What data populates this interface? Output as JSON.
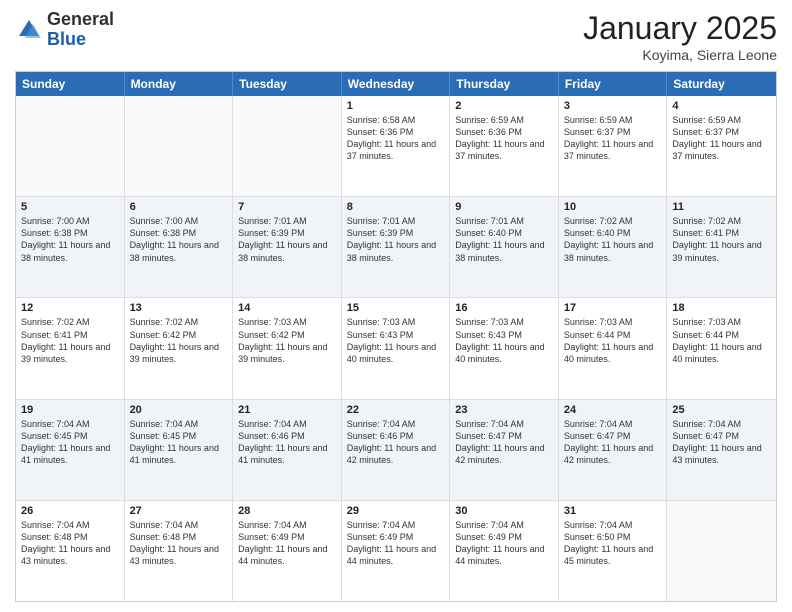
{
  "logo": {
    "general": "General",
    "blue": "Blue"
  },
  "header": {
    "month": "January 2025",
    "location": "Koyima, Sierra Leone"
  },
  "weekdays": [
    "Sunday",
    "Monday",
    "Tuesday",
    "Wednesday",
    "Thursday",
    "Friday",
    "Saturday"
  ],
  "rows": [
    {
      "alt": false,
      "cells": [
        {
          "day": "",
          "text": ""
        },
        {
          "day": "",
          "text": ""
        },
        {
          "day": "",
          "text": ""
        },
        {
          "day": "1",
          "text": "Sunrise: 6:58 AM\nSunset: 6:36 PM\nDaylight: 11 hours and 37 minutes."
        },
        {
          "day": "2",
          "text": "Sunrise: 6:59 AM\nSunset: 6:36 PM\nDaylight: 11 hours and 37 minutes."
        },
        {
          "day": "3",
          "text": "Sunrise: 6:59 AM\nSunset: 6:37 PM\nDaylight: 11 hours and 37 minutes."
        },
        {
          "day": "4",
          "text": "Sunrise: 6:59 AM\nSunset: 6:37 PM\nDaylight: 11 hours and 37 minutes."
        }
      ]
    },
    {
      "alt": true,
      "cells": [
        {
          "day": "5",
          "text": "Sunrise: 7:00 AM\nSunset: 6:38 PM\nDaylight: 11 hours and 38 minutes."
        },
        {
          "day": "6",
          "text": "Sunrise: 7:00 AM\nSunset: 6:38 PM\nDaylight: 11 hours and 38 minutes."
        },
        {
          "day": "7",
          "text": "Sunrise: 7:01 AM\nSunset: 6:39 PM\nDaylight: 11 hours and 38 minutes."
        },
        {
          "day": "8",
          "text": "Sunrise: 7:01 AM\nSunset: 6:39 PM\nDaylight: 11 hours and 38 minutes."
        },
        {
          "day": "9",
          "text": "Sunrise: 7:01 AM\nSunset: 6:40 PM\nDaylight: 11 hours and 38 minutes."
        },
        {
          "day": "10",
          "text": "Sunrise: 7:02 AM\nSunset: 6:40 PM\nDaylight: 11 hours and 38 minutes."
        },
        {
          "day": "11",
          "text": "Sunrise: 7:02 AM\nSunset: 6:41 PM\nDaylight: 11 hours and 39 minutes."
        }
      ]
    },
    {
      "alt": false,
      "cells": [
        {
          "day": "12",
          "text": "Sunrise: 7:02 AM\nSunset: 6:41 PM\nDaylight: 11 hours and 39 minutes."
        },
        {
          "day": "13",
          "text": "Sunrise: 7:02 AM\nSunset: 6:42 PM\nDaylight: 11 hours and 39 minutes."
        },
        {
          "day": "14",
          "text": "Sunrise: 7:03 AM\nSunset: 6:42 PM\nDaylight: 11 hours and 39 minutes."
        },
        {
          "day": "15",
          "text": "Sunrise: 7:03 AM\nSunset: 6:43 PM\nDaylight: 11 hours and 40 minutes."
        },
        {
          "day": "16",
          "text": "Sunrise: 7:03 AM\nSunset: 6:43 PM\nDaylight: 11 hours and 40 minutes."
        },
        {
          "day": "17",
          "text": "Sunrise: 7:03 AM\nSunset: 6:44 PM\nDaylight: 11 hours and 40 minutes."
        },
        {
          "day": "18",
          "text": "Sunrise: 7:03 AM\nSunset: 6:44 PM\nDaylight: 11 hours and 40 minutes."
        }
      ]
    },
    {
      "alt": true,
      "cells": [
        {
          "day": "19",
          "text": "Sunrise: 7:04 AM\nSunset: 6:45 PM\nDaylight: 11 hours and 41 minutes."
        },
        {
          "day": "20",
          "text": "Sunrise: 7:04 AM\nSunset: 6:45 PM\nDaylight: 11 hours and 41 minutes."
        },
        {
          "day": "21",
          "text": "Sunrise: 7:04 AM\nSunset: 6:46 PM\nDaylight: 11 hours and 41 minutes."
        },
        {
          "day": "22",
          "text": "Sunrise: 7:04 AM\nSunset: 6:46 PM\nDaylight: 11 hours and 42 minutes."
        },
        {
          "day": "23",
          "text": "Sunrise: 7:04 AM\nSunset: 6:47 PM\nDaylight: 11 hours and 42 minutes."
        },
        {
          "day": "24",
          "text": "Sunrise: 7:04 AM\nSunset: 6:47 PM\nDaylight: 11 hours and 42 minutes."
        },
        {
          "day": "25",
          "text": "Sunrise: 7:04 AM\nSunset: 6:47 PM\nDaylight: 11 hours and 43 minutes."
        }
      ]
    },
    {
      "alt": false,
      "cells": [
        {
          "day": "26",
          "text": "Sunrise: 7:04 AM\nSunset: 6:48 PM\nDaylight: 11 hours and 43 minutes."
        },
        {
          "day": "27",
          "text": "Sunrise: 7:04 AM\nSunset: 6:48 PM\nDaylight: 11 hours and 43 minutes."
        },
        {
          "day": "28",
          "text": "Sunrise: 7:04 AM\nSunset: 6:49 PM\nDaylight: 11 hours and 44 minutes."
        },
        {
          "day": "29",
          "text": "Sunrise: 7:04 AM\nSunset: 6:49 PM\nDaylight: 11 hours and 44 minutes."
        },
        {
          "day": "30",
          "text": "Sunrise: 7:04 AM\nSunset: 6:49 PM\nDaylight: 11 hours and 44 minutes."
        },
        {
          "day": "31",
          "text": "Sunrise: 7:04 AM\nSunset: 6:50 PM\nDaylight: 11 hours and 45 minutes."
        },
        {
          "day": "",
          "text": ""
        }
      ]
    }
  ]
}
